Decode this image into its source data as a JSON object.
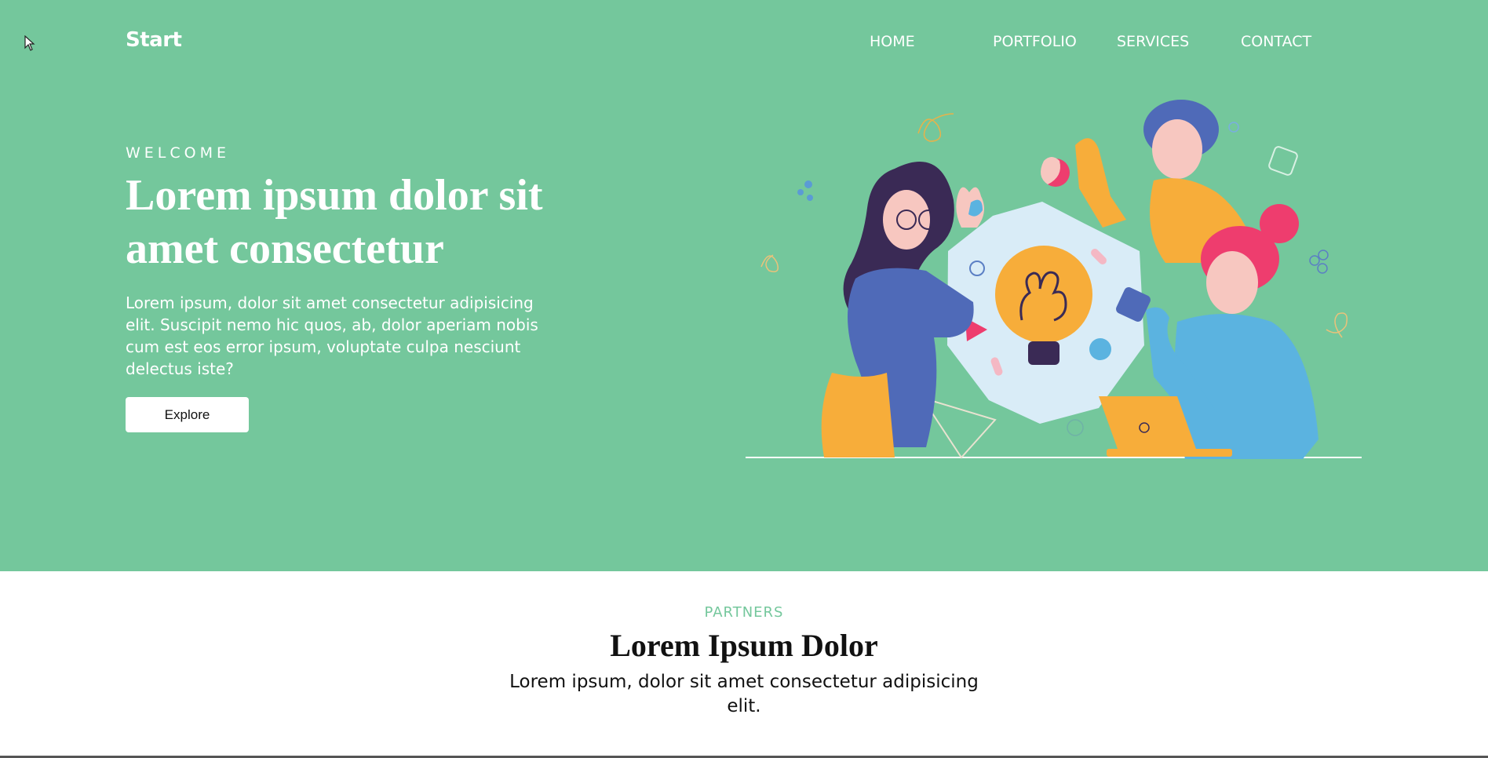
{
  "header": {
    "logo": "Start",
    "nav": [
      "HOME",
      "PORTFOLIO",
      "SERVICES",
      "CONTACT"
    ]
  },
  "hero": {
    "eyebrow": "WELCOME",
    "headline": "Lorem ipsum dolor sit amet consectetur",
    "lead": "Lorem ipsum, dolor sit amet consectetur adipisicing elit. Suscipit nemo hic quos, ab, dolor aperiam nobis cum est eos error ipsum, voluptate culpa nesciunt delectus iste?",
    "button_label": "Explore"
  },
  "partners": {
    "eyebrow": "PARTNERS",
    "title": "Lorem Ipsum Dolor",
    "text": "Lorem ipsum, dolor sit amet consectetur adipisicing elit."
  },
  "colors": {
    "hero_bg": "#74c79c",
    "accent": "#74c79c",
    "text_dark": "#111111"
  },
  "icons": [
    "cursor-icon",
    "teamwork-illustration"
  ]
}
